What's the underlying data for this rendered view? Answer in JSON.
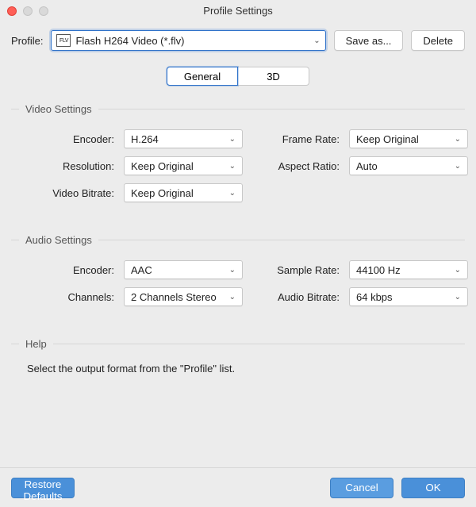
{
  "window": {
    "title": "Profile Settings"
  },
  "profileRow": {
    "label": "Profile:",
    "iconText": "FLV",
    "value": "Flash H264 Video (*.flv)",
    "saveAs": "Save as...",
    "delete": "Delete"
  },
  "tabs": {
    "general": "General",
    "threeD": "3D"
  },
  "video": {
    "title": "Video Settings",
    "encoderLabel": "Encoder:",
    "encoderValue": "H.264",
    "frameRateLabel": "Frame Rate:",
    "frameRateValue": "Keep Original",
    "resolutionLabel": "Resolution:",
    "resolutionValue": "Keep Original",
    "aspectLabel": "Aspect Ratio:",
    "aspectValue": "Auto",
    "bitrateLabel": "Video Bitrate:",
    "bitrateValue": "Keep Original"
  },
  "audio": {
    "title": "Audio Settings",
    "encoderLabel": "Encoder:",
    "encoderValue": "AAC",
    "sampleLabel": "Sample Rate:",
    "sampleValue": "44100 Hz",
    "channelsLabel": "Channels:",
    "channelsValue": "2 Channels Stereo",
    "bitrateLabel": "Audio Bitrate:",
    "bitrateValue": "64 kbps"
  },
  "help": {
    "title": "Help",
    "text": "Select the output format from the \"Profile\" list."
  },
  "footer": {
    "restore": "Restore Defaults",
    "cancel": "Cancel",
    "ok": "OK"
  }
}
